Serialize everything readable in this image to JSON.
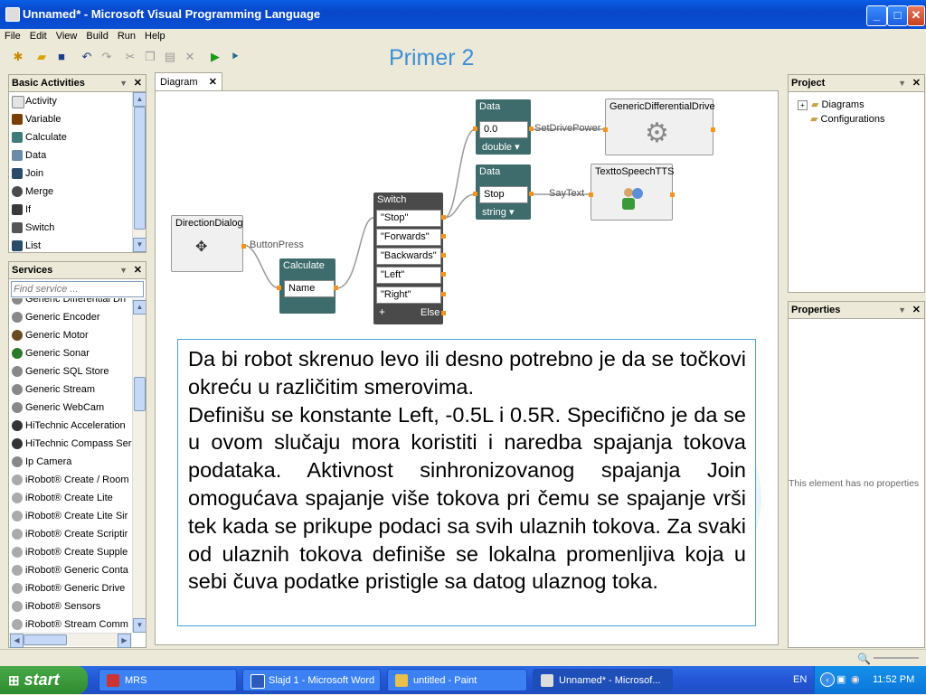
{
  "window": {
    "title": "Unnamed* - Microsoft Visual Programming Language",
    "min": "_",
    "max": "□",
    "close": "✕"
  },
  "menu": [
    "File",
    "Edit",
    "View",
    "Build",
    "Run",
    "Help"
  ],
  "slide_title": "Primer 2",
  "basic_activities": {
    "header": "Basic Activities",
    "items": [
      "Activity",
      "Variable",
      "Calculate",
      "Data",
      "Join",
      "Merge",
      "If",
      "Switch",
      "List"
    ]
  },
  "services": {
    "header": "Services",
    "search_placeholder": "Find service ...",
    "items": [
      "Generic Differential Dri",
      "Generic Encoder",
      "Generic Motor",
      "Generic Sonar",
      "Generic SQL Store",
      "Generic Stream",
      "Generic WebCam",
      "HiTechnic Acceleration",
      "HiTechnic Compass Ser",
      "Ip Camera",
      "iRobot® Create / Room",
      "iRobot® Create Lite",
      "iRobot® Create Lite Sir",
      "iRobot® Create Scriptir",
      "iRobot® Create Supple",
      "iRobot® Generic Conta",
      "iRobot® Generic Drive",
      "iRobot® Sensors",
      "iRobot® Stream Comm"
    ]
  },
  "diagram": {
    "tab": "Diagram",
    "direction_dialog": "DirectionDialog",
    "button_press": "ButtonPress",
    "calculate": {
      "title": "Calculate",
      "field": "Name"
    },
    "switch": {
      "title": "Switch",
      "cases": [
        "\"Stop\"",
        "\"Forwards\"",
        "\"Backwards\"",
        "\"Left\"",
        "\"Right\""
      ],
      "add": "+",
      "else": "Else"
    },
    "data1": {
      "title": "Data",
      "value": "0.0",
      "type": "double"
    },
    "data2": {
      "title": "Data",
      "value": "Stop",
      "type": "string"
    },
    "set_drive_power": "SetDrivePower",
    "say_text": "SayText",
    "generic_drive": "GenericDifferentialDrive",
    "tts": "TexttoSpeechTTS"
  },
  "text": {
    "p1": "Da bi robot skrenuo levo ili desno potrebno je da se točkovi okreću u različitim smerovima.",
    "p2": "Definišu se konstante Left, -0.5L i 0.5R. Specifično je da se u ovom slučaju mora koristiti i naredba spajanja tokova podataka. Aktivnost sinhronizovanog spajanja Join omogućava spajanje više tokova pri čemu se spajanje vrši tek kada se prikupe podaci sa svih ulaznih tokova. Za svaki od ulaznih tokova definiše se lokalna promenljiva koja u sebi čuva podatke pristigle sa datog ulaznog toka."
  },
  "project": {
    "header": "Project",
    "items": [
      "Diagrams",
      "Configurations"
    ]
  },
  "properties": {
    "header": "Properties",
    "empty": "This element has no properties"
  },
  "taskbar": {
    "start": "start",
    "tasks": [
      "MRS",
      "Slajd 1 - Microsoft Word",
      "untitled - Paint",
      "Unnamed* - Microsof..."
    ],
    "lang": "EN",
    "clock": "11:52 PM"
  },
  "colors": {
    "accent": "#3d8fd6",
    "node_dark": "#3e6b6b",
    "port": "#f7941d"
  }
}
